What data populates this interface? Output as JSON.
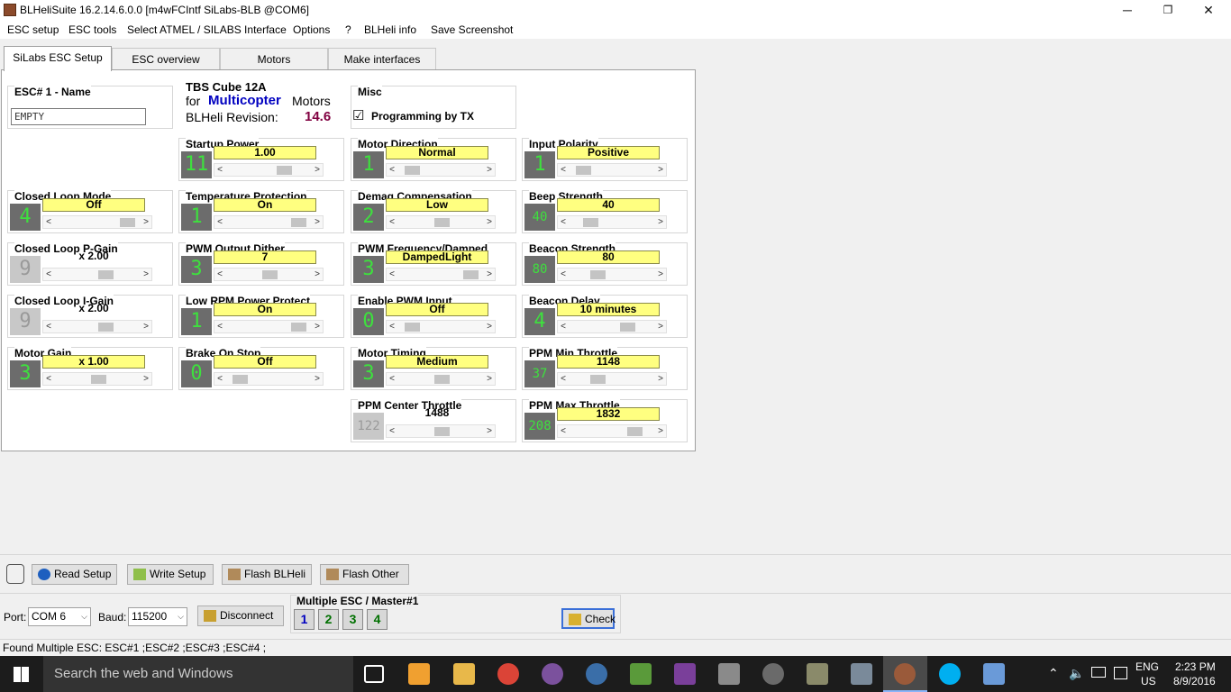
{
  "window": {
    "title": "BLHeliSuite 16.2.14.6.0.0  [m4wFCIntf SiLabs-BLB @COM6]",
    "minimize": "─",
    "maximize": "❐",
    "close": "✕"
  },
  "menu": [
    "ESC setup",
    "ESC tools",
    "Select ATMEL / SILABS Interface",
    "Options",
    "?",
    "BLHeli info",
    "Save Screenshot"
  ],
  "tabs": [
    "SiLabs ESC Setup",
    "ESC overview",
    "Motors",
    "Make interfaces"
  ],
  "esc_name": {
    "label": "ESC# 1 - Name",
    "value": "EMPTY"
  },
  "device": {
    "name": "TBS Cube 12A",
    "for": "for",
    "type": "Multicopter",
    "motors": "Motors",
    "rev_label": "BLHeli Revision:",
    "rev": "14.6"
  },
  "misc": {
    "label": "Misc",
    "checkbox": "Programming by TX",
    "checked": "☑"
  },
  "params": {
    "startup_power": {
      "label": "Startup Power",
      "num": "11",
      "value": "1.00",
      "level": 0.7
    },
    "motor_direction": {
      "label": "Motor Direction",
      "num": "1",
      "value": "Normal",
      "level": 0.1
    },
    "input_polarity": {
      "label": "Input Polarity",
      "num": "1",
      "value": "Positive",
      "level": 0.1
    },
    "closed_loop_mode": {
      "label": "Closed Loop Mode",
      "num": "4",
      "value": "Off",
      "level": 0.9
    },
    "temp_protection": {
      "label": "Temperature Protection",
      "num": "1",
      "value": "On",
      "level": 0.9
    },
    "demag": {
      "label": "Demag Compensation",
      "num": "2",
      "value": "Low",
      "level": 0.5
    },
    "beep": {
      "label": "Beep Strength",
      "num": "40",
      "value": "40",
      "level": 0.2
    },
    "p_gain": {
      "label": "Closed Loop P-Gain",
      "num": "9",
      "value": "x 2.00",
      "level": 0.6
    },
    "pwm_dither": {
      "label": "PWM Output Dither",
      "num": "3",
      "value": "7",
      "level": 0.5
    },
    "pwm_freq": {
      "label": "PWM Frequency/Damped",
      "num": "3",
      "value": "DampedLight",
      "level": 0.9
    },
    "beacon_strength": {
      "label": "Beacon Strength",
      "num": "80",
      "value": "80",
      "level": 0.3
    },
    "i_gain": {
      "label": "Closed Loop I-Gain",
      "num": "9",
      "value": "x 2.00",
      "level": 0.6
    },
    "low_rpm": {
      "label": "Low RPM Power Protect",
      "num": "1",
      "value": "On",
      "level": 0.9
    },
    "enable_pwm": {
      "label": "Enable PWM Input",
      "num": "0",
      "value": "Off",
      "level": 0.1
    },
    "beacon_delay": {
      "label": "Beacon Delay",
      "num": "4",
      "value": "10 minutes",
      "level": 0.7
    },
    "motor_gain": {
      "label": "Motor Gain",
      "num": "3",
      "value": "x 1.00",
      "level": 0.5
    },
    "brake": {
      "label": "Brake On Stop",
      "num": "0",
      "value": "Off",
      "level": 0.1
    },
    "motor_timing": {
      "label": "Motor Timing",
      "num": "3",
      "value": "Medium",
      "level": 0.5
    },
    "ppm_min": {
      "label": "PPM Min Throttle",
      "num": "37",
      "value": "1148",
      "level": 0.3
    },
    "ppm_center": {
      "label": "PPM Center Throttle",
      "num": "122",
      "value": "1488",
      "level": 0.5
    },
    "ppm_max": {
      "label": "PPM Max Throttle",
      "num": "208",
      "value": "1832",
      "level": 0.8
    }
  },
  "buttons": {
    "read": "Read Setup",
    "write": "Write Setup",
    "flash_blheli": "Flash BLHeli",
    "flash_other": "Flash Other",
    "disconnect": "Disconnect",
    "check": "Check"
  },
  "connection": {
    "port_label": "Port:",
    "port": "COM 6",
    "baud_label": "Baud:",
    "baud": "115200"
  },
  "multi_esc": {
    "label": "Multiple ESC / Master#1",
    "escs": [
      "1",
      "2",
      "3",
      "4"
    ]
  },
  "status": "Found Multiple ESC: ESC#1 ;ESC#2 ;ESC#3 ;ESC#4 ;",
  "taskbar": {
    "search": "Search the web and Windows",
    "lang": "ENG",
    "region": "US",
    "time": "2:23 PM",
    "date": "8/9/2016"
  },
  "colors": {
    "accent": "#0000c0",
    "revision": "#800040",
    "digit": "#3ee03e",
    "value_bg": "#ffff80"
  }
}
